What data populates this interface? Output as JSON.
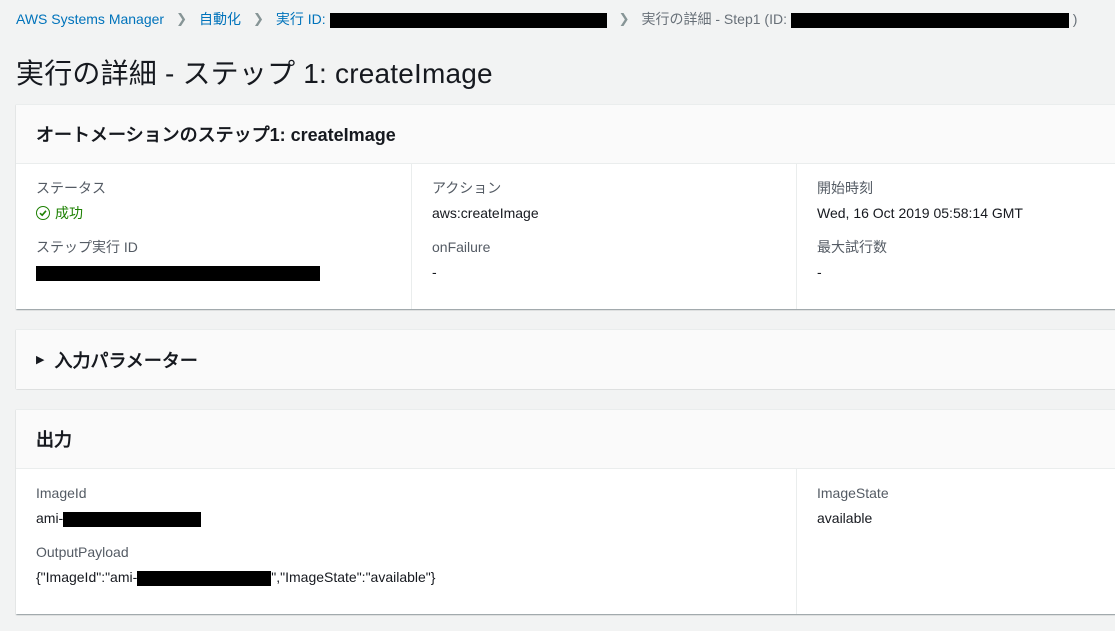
{
  "breadcrumb": {
    "items": [
      {
        "label": "AWS Systems Manager"
      },
      {
        "label": "自動化"
      },
      {
        "label": "実行 ID:"
      }
    ],
    "current_prefix": "実行の詳細 - Step1 (ID:",
    "current_suffix": ")"
  },
  "page": {
    "title": "実行の詳細 - ステップ 1: createImage"
  },
  "step_panel": {
    "header": "オートメーションのステップ1: createImage",
    "status_label": "ステータス",
    "status_value": "成功",
    "step_exec_id_label": "ステップ実行 ID",
    "action_label": "アクション",
    "action_value": "aws:createImage",
    "onfailure_label": "onFailure",
    "onfailure_value": "-",
    "start_time_label": "開始時刻",
    "start_time_value": "Wed, 16 Oct 2019 05:58:14 GMT",
    "max_attempts_label": "最大試行数",
    "max_attempts_value": "-"
  },
  "input_panel": {
    "header": "入力パラメーター"
  },
  "output_panel": {
    "header": "出力",
    "image_id_label": "ImageId",
    "image_id_prefix": "ami-",
    "output_payload_label": "OutputPayload",
    "payload_prefix": "{\"ImageId\":\"ami-",
    "payload_suffix": "\",\"ImageState\":\"available\"}",
    "image_state_label": "ImageState",
    "image_state_value": "available"
  },
  "colors": {
    "link": "#0073bb",
    "success": "#1d8102",
    "background": "#f2f3f3"
  }
}
